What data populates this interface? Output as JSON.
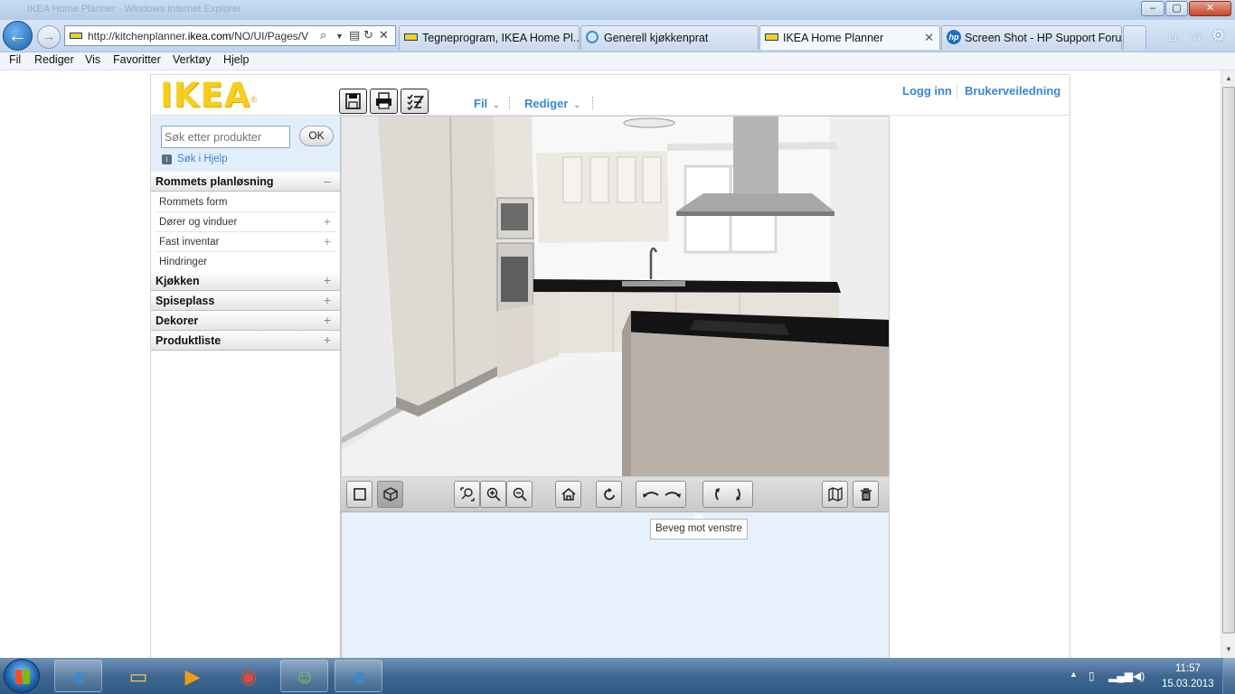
{
  "browser": {
    "window_title": "IKEA Home Planner - Windows Internet Explorer",
    "address_prefix": "http://kitchenplanner.",
    "address_domain": "ikea.com",
    "address_suffix": "/NO/UI/Pages/V",
    "tabs": [
      {
        "label": "Tegneprogram, IKEA Home Pl...",
        "icon": "ikea-favicon"
      },
      {
        "label": "Generell kjøkkenprat",
        "icon": "ie-favicon"
      },
      {
        "label": "IKEA Home Planner",
        "icon": "ikea-favicon",
        "active": true,
        "close": "✕"
      },
      {
        "label": "Screen Shot - HP Support Foru...",
        "icon": "hp-favicon"
      }
    ],
    "menu": [
      "Fil",
      "Rediger",
      "Vis",
      "Favoritter",
      "Verktøy",
      "Hjelp"
    ]
  },
  "app": {
    "logo_text": "IKEA",
    "top_menu": [
      {
        "label": "Fil"
      },
      {
        "label": "Rediger"
      }
    ],
    "top_links": {
      "login": "Logg inn",
      "guide": "Brukerveiledning"
    },
    "search": {
      "placeholder": "Søk etter produkter",
      "ok_label": "OK",
      "help_link": "Søk i Hjelp"
    },
    "sidebar": {
      "section_room": "Rommets planløsning",
      "room_items": [
        "Rommets form",
        "Dører og vinduer",
        "Fast inventar",
        "Hindringer"
      ],
      "section_kitchen": "Kjøkken",
      "section_dining": "Spiseplass",
      "section_decor": "Dekorer",
      "section_products": "Produktliste"
    },
    "tooltip": "Beveg mot venstre"
  },
  "taskbar": {
    "time": "11:57",
    "date": "15.03.2013"
  },
  "colors": {
    "ikea_yellow": "#f8cd1e",
    "link_blue": "#3a86d6",
    "panel_blue": "#e6f1fc"
  }
}
